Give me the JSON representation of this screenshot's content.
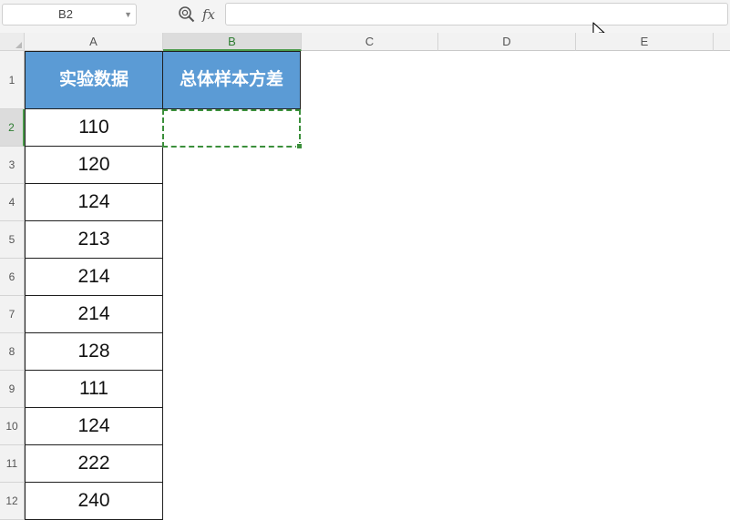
{
  "name_box": {
    "value": "B2"
  },
  "formula_bar": {
    "fx_label": "fx",
    "value": ""
  },
  "columns": [
    "A",
    "B",
    "C",
    "D",
    "E"
  ],
  "rows": [
    "1",
    "2",
    "3",
    "4",
    "5",
    "6",
    "7",
    "8",
    "9",
    "10",
    "11",
    "12"
  ],
  "headers": {
    "a1": "实验数据",
    "b1": "总体样本方差"
  },
  "data": [
    "110",
    "120",
    "124",
    "213",
    "214",
    "214",
    "128",
    "111",
    "124",
    "222",
    "240"
  ],
  "active_cell": "B2",
  "colors": {
    "header_fill": "#5b9bd5",
    "selection": "#3b8f3b"
  }
}
